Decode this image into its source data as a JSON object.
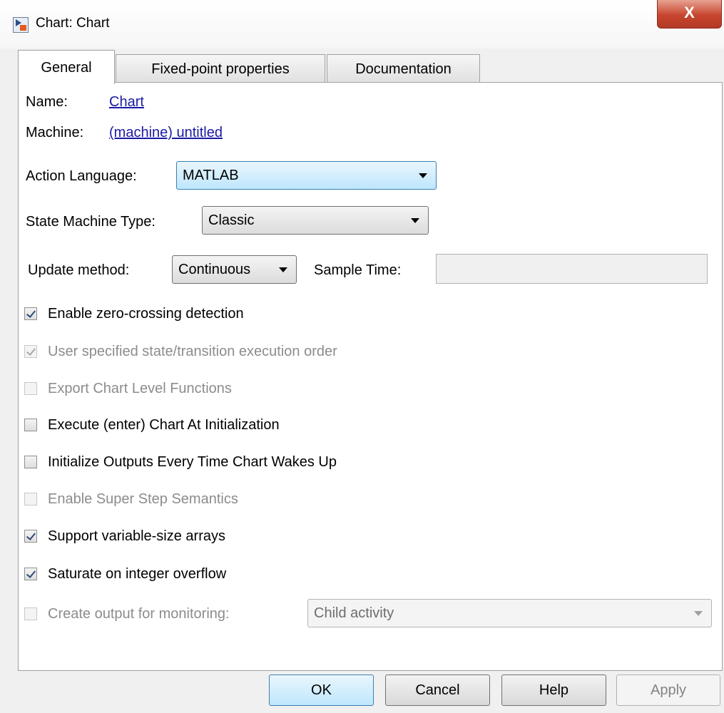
{
  "window": {
    "title": "Chart: Chart",
    "close_label": "X"
  },
  "tabs": [
    {
      "label": "General",
      "active": true
    },
    {
      "label": "Fixed-point properties",
      "active": false
    },
    {
      "label": "Documentation",
      "active": false
    }
  ],
  "general": {
    "name_label": "Name:",
    "name_value": "Chart",
    "machine_label": "Machine:",
    "machine_value": "(machine) untitled",
    "action_language_label": "Action Language:",
    "action_language_value": "MATLAB",
    "state_machine_type_label": "State Machine Type:",
    "state_machine_type_value": "Classic",
    "update_method_label": "Update method:",
    "update_method_value": "Continuous",
    "sample_time_label": "Sample Time:",
    "sample_time_value": ""
  },
  "checkboxes": [
    {
      "label": "Enable zero-crossing detection",
      "checked": true,
      "enabled": true
    },
    {
      "label": "User specified state/transition execution order",
      "checked": true,
      "enabled": false
    },
    {
      "label": "Export Chart Level Functions",
      "checked": false,
      "enabled": false
    },
    {
      "label": "Execute (enter) Chart At Initialization",
      "checked": false,
      "enabled": true
    },
    {
      "label": "Initialize Outputs Every Time Chart Wakes Up",
      "checked": false,
      "enabled": true
    },
    {
      "label": "Enable Super Step Semantics",
      "checked": false,
      "enabled": false
    },
    {
      "label": "Support variable-size arrays",
      "checked": true,
      "enabled": true
    },
    {
      "label": "Saturate on integer overflow",
      "checked": true,
      "enabled": true
    },
    {
      "label": "Create output for monitoring:",
      "checked": false,
      "enabled": false
    }
  ],
  "monitoring_value": "Child activity",
  "buttons": {
    "ok": "OK",
    "cancel": "Cancel",
    "help": "Help",
    "apply": "Apply"
  }
}
